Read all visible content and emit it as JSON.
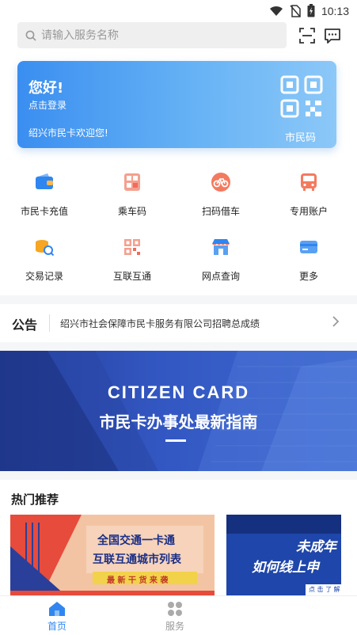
{
  "status_bar": {
    "time": "10:13"
  },
  "search": {
    "placeholder": "请输入服务名称"
  },
  "card": {
    "greeting": "您好!",
    "login_label": "点击登录",
    "welcome": "绍兴市民卡欢迎您!",
    "qr_label": "市民码"
  },
  "services": [
    {
      "label": "市民卡充值",
      "icon": "wallet-icon"
    },
    {
      "label": "乘车码",
      "icon": "bus-qr-icon"
    },
    {
      "label": "扫码借车",
      "icon": "bike-icon"
    },
    {
      "label": "专用账户",
      "icon": "bus-icon"
    },
    {
      "label": "交易记录",
      "icon": "coins-search-icon"
    },
    {
      "label": "互联互通",
      "icon": "qr-code-icon"
    },
    {
      "label": "网点查询",
      "icon": "store-icon"
    },
    {
      "label": "更多",
      "icon": "card-icon"
    }
  ],
  "notice": {
    "tag": "公告",
    "text": "绍兴市社会保障市民卡服务有限公司招聘总成绩"
  },
  "banner": {
    "title_en": "CITIZEN CARD",
    "title_cn": "市民卡办事处最新指南"
  },
  "hot": {
    "title": "热门推荐",
    "promo1": {
      "line1": "全国交通一卡通",
      "line2": "互联互通城市列表",
      "line3": "最 新 干 货 来 袭"
    },
    "promo2": {
      "line1": "未成年",
      "line2": "如何线上申",
      "line3": "点 击 了 解"
    }
  },
  "tabs": [
    {
      "label": "首页",
      "active": true
    },
    {
      "label": "服务",
      "active": false
    }
  ],
  "colors": {
    "accent": "#2f86f0",
    "card_start": "#3a8ef0",
    "icon_red": "#f26b5b",
    "icon_blue": "#2f86f0",
    "icon_orange": "#f5a623"
  }
}
